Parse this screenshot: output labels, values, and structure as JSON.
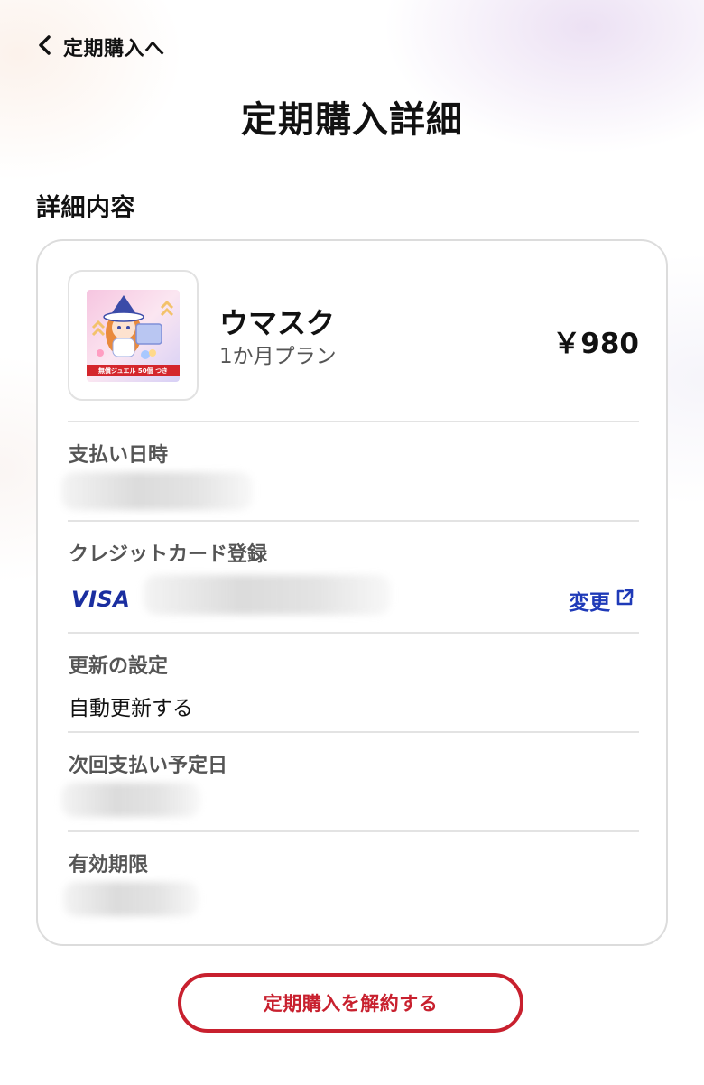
{
  "nav": {
    "back_label": "定期購入へ"
  },
  "page_title": "定期購入詳細",
  "section_title": "詳細内容",
  "product": {
    "name": "ウマスク",
    "plan": "1か月プラン",
    "price": "￥980",
    "thumbnail_banner_text": "無償ジュエル 50個 つき"
  },
  "details": {
    "payment_datetime_label": "支払い日時",
    "credit_card_label": "クレジットカード登録",
    "card_brand": "VISA",
    "change_label": "変更",
    "renewal_label": "更新の設定",
    "renewal_value": "自動更新する",
    "next_payment_label": "次回支払い予定日",
    "expiry_label": "有効期限"
  },
  "cancel_button": "定期購入を解約する",
  "colors": {
    "accent_red": "#c8202e",
    "link_blue": "#1f3ab8",
    "visa_blue": "#1a2ea0"
  },
  "icons": [
    "chevron-left-icon",
    "external-link-icon"
  ]
}
